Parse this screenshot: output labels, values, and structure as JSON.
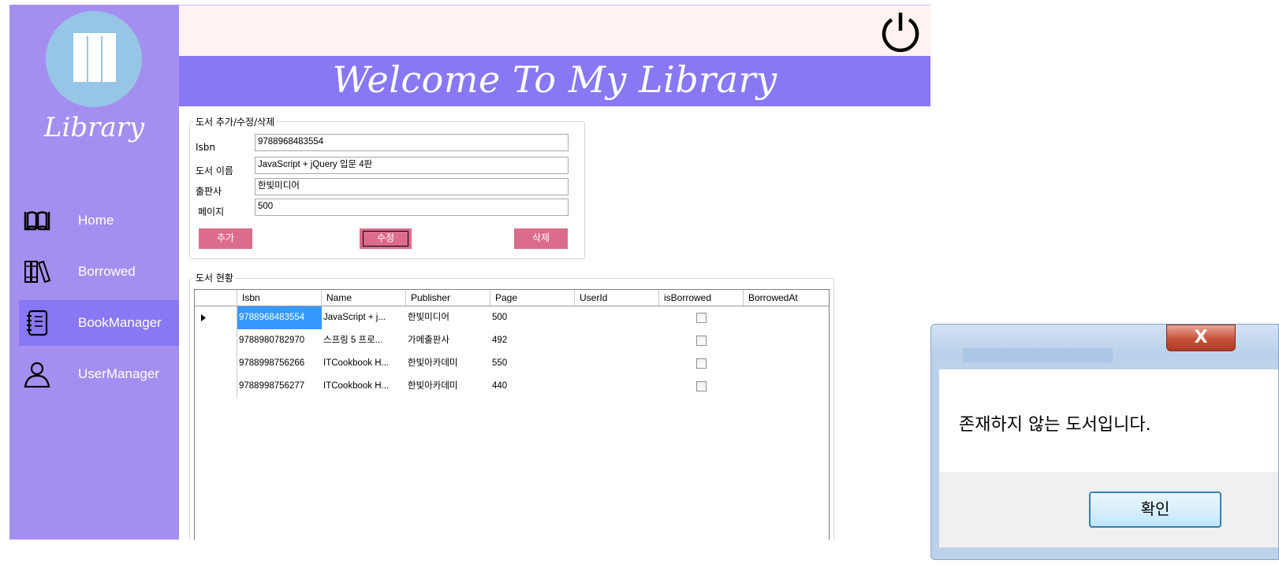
{
  "sidebar": {
    "logo_text": "Library",
    "items": [
      {
        "label": "Home",
        "icon": "open-book-icon"
      },
      {
        "label": "Borrowed",
        "icon": "books-stack-icon"
      },
      {
        "label": "BookManager",
        "icon": "notebook-icon",
        "active": true
      },
      {
        "label": "UserManager",
        "icon": "user-icon"
      }
    ]
  },
  "header": {
    "banner_title": "Welcome To My Library",
    "power_icon": "power-icon"
  },
  "form": {
    "legend": "도서 추가/수정/삭제",
    "isbn_label": "Isbn",
    "isbn_value": "9788968483554",
    "name_label": "도서 이름",
    "name_value": "JavaScript + jQuery 입문 4판",
    "publisher_label": "출판사",
    "publisher_value": "한빛미디어",
    "page_label": "페이지",
    "page_value": "500",
    "add_label": "추가",
    "edit_label": "수정",
    "delete_label": "삭제"
  },
  "list": {
    "legend": "도서 현황",
    "columns": [
      "Isbn",
      "Name",
      "Publisher",
      "Page",
      "UserId",
      "isBorrowed",
      "BorrowedAt"
    ],
    "rows": [
      {
        "isbn": "9788968483554",
        "name": "JavaScript + j...",
        "publisher": "한빛미디어",
        "page": "500",
        "borrowed": false
      },
      {
        "isbn": "9788980782970",
        "name": "스프링 5 프로...",
        "publisher": "가메출판사",
        "page": "492",
        "borrowed": false
      },
      {
        "isbn": "9788998756266",
        "name": "ITCookbook H...",
        "publisher": "한빛아카데미",
        "page": "550",
        "borrowed": false
      },
      {
        "isbn": "9788998756277",
        "name": "ITCookbook H...",
        "publisher": "한빛아카데미",
        "page": "440",
        "borrowed": false
      }
    ]
  },
  "dialog": {
    "close_label": "X",
    "message": "존재하지 않는 도서입니다.",
    "ok_label": "확인"
  },
  "colors": {
    "sidebar": "#a48ff0",
    "banner": "#8878f3",
    "topbar": "#fff2f0",
    "button": "#dc6c8c"
  }
}
